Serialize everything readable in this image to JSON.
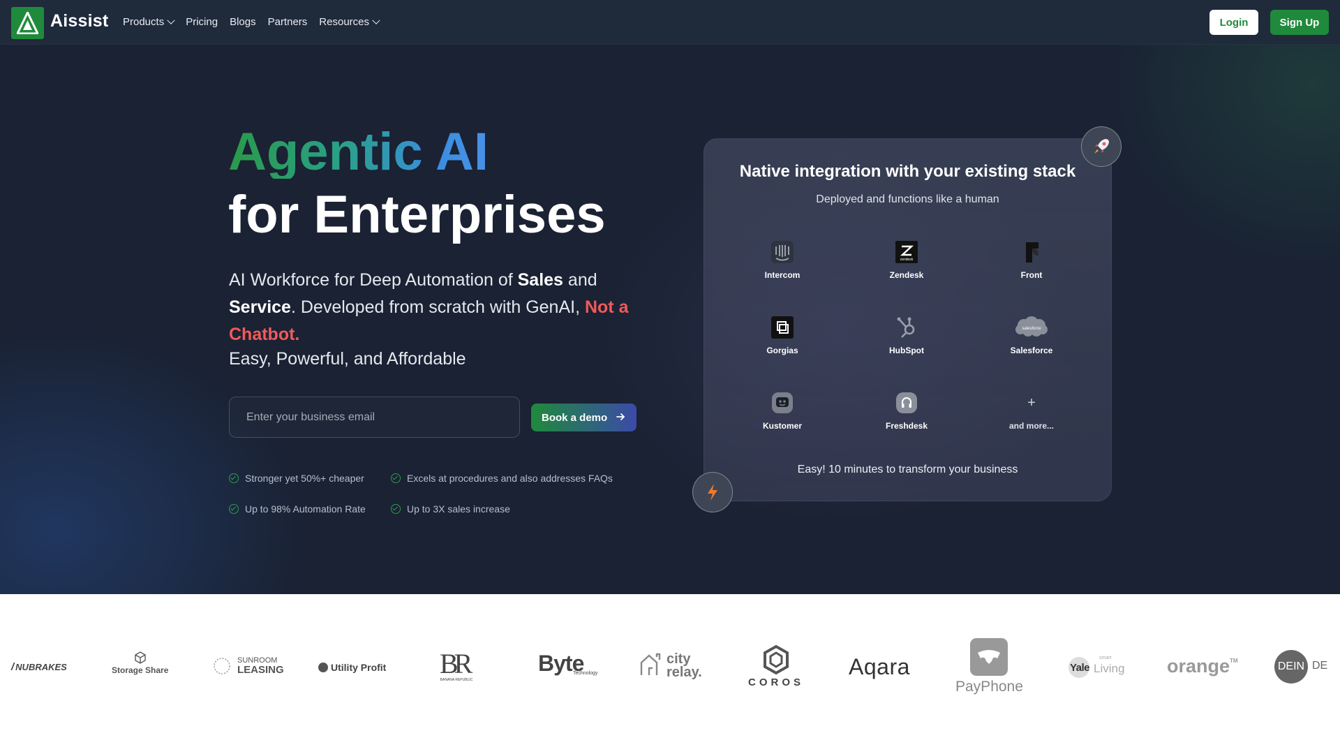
{
  "brand": {
    "name": "Aissist",
    "accent": "#1f8a3c"
  },
  "nav": {
    "items": [
      {
        "label": "Products",
        "dropdown": true
      },
      {
        "label": "Pricing",
        "dropdown": false
      },
      {
        "label": "Blogs",
        "dropdown": false
      },
      {
        "label": "Partners",
        "dropdown": false
      },
      {
        "label": "Resources",
        "dropdown": true
      }
    ],
    "login": "Login",
    "signup": "Sign Up"
  },
  "hero": {
    "title_line1": "Agentic AI",
    "title_line2": "for Enterprises",
    "sub_part1": "AI Workforce for Deep Automation of ",
    "sub_sales": "Sales",
    "sub_and": " and ",
    "sub_service": "Service",
    "sub_part2": ". Developed from scratch with GenAI, ",
    "sub_red": "Not a Chatbot.",
    "tagline": "Easy, Powerful, and Affordable",
    "email_placeholder": "Enter your business email",
    "cta": "Book a demo",
    "features": [
      "Stronger yet 50%+ cheaper",
      "Excels at procedures and also addresses FAQs",
      "Up to 98% Automation Rate",
      "Up to 3X sales increase"
    ]
  },
  "integrations": {
    "title": "Native integration with your existing stack",
    "subtitle": "Deployed and functions like a human",
    "items": [
      {
        "label": "Intercom",
        "icon": "intercom-icon"
      },
      {
        "label": "Zendesk",
        "icon": "zendesk-icon"
      },
      {
        "label": "Front",
        "icon": "front-icon"
      },
      {
        "label": "Gorgias",
        "icon": "gorgias-icon"
      },
      {
        "label": "HubSpot",
        "icon": "hubspot-icon"
      },
      {
        "label": "Salesforce",
        "icon": "salesforce-icon"
      },
      {
        "label": "Kustomer",
        "icon": "kustomer-icon"
      },
      {
        "label": "Freshdesk",
        "icon": "freshdesk-icon"
      },
      {
        "label": "and more...",
        "icon": "plus-icon"
      }
    ],
    "footer": "Easy! 10 minutes to transform your business",
    "salesforce_mark": "salesforce",
    "zendesk_mark": "zendesk",
    "plus": "+"
  },
  "logos": {
    "nubrakes": "NUBRAKES",
    "storageshare": "Storage Share",
    "sunroom_1": "SUNROOM",
    "sunroom_2": "LEASING",
    "utilityprofit": "Utility Profit",
    "banana_mark": "BR",
    "banana_sub": "BANANA REPUBLIC",
    "byte": "Byte",
    "byte_sub": "Technology",
    "cityrelay_1": "city",
    "cityrelay_2": "relay.",
    "coros": "COROS",
    "aqara": "Aqara",
    "payphone": "PayPhone",
    "yale_1": "Yale",
    "yale_2": "Living",
    "yale_small": "smart",
    "orange": "orange",
    "orange_tm": "TM",
    "dein": "DEIN",
    "dein_tail": "DE"
  }
}
